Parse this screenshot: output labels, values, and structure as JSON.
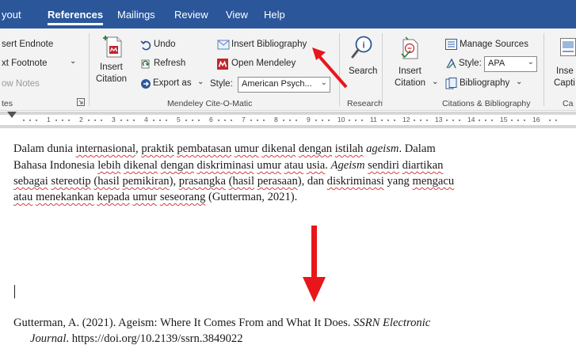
{
  "tabs": [
    "Layout",
    "References",
    "Mailings",
    "Review",
    "View",
    "Help"
  ],
  "tab_visible": {
    "layout": "yout"
  },
  "active_tab": "References",
  "ribbon": {
    "footnotes": {
      "insert_endnote": "sert Endnote",
      "next_footnote": "xt Footnote",
      "next_footnote_chevron": "⌄",
      "show_notes": "ow Notes",
      "group_label": "tes"
    },
    "mendeley": {
      "insert_citation_line1": "Insert",
      "insert_citation_line2": "Citation",
      "undo": "Undo",
      "refresh": "Refresh",
      "export_as": "Export as",
      "insert_bibliography": "Insert Bibliography",
      "open_mendeley": "Open Mendeley",
      "style_label": "Style:",
      "style_value": "American Psych...",
      "group_label": "Mendeley Cite-O-Matic"
    },
    "research": {
      "search": "Search",
      "group_label": "Research"
    },
    "citations": {
      "insert_citation_line1": "Insert",
      "insert_citation_line2": "Citation",
      "manage_sources": "Manage Sources",
      "style_label": "Style:",
      "style_value": "APA",
      "bibliography": "Bibliography",
      "group_label": "Citations & Bibliography"
    },
    "captions": {
      "insert_caption_line1": "Inse",
      "insert_caption_line2": "Capti",
      "group_label": "Ca"
    }
  },
  "ruler": {
    "numbers": [
      "1",
      "2",
      "3",
      "4",
      "5",
      "6",
      "7",
      "8",
      "9",
      "10",
      "11",
      "12",
      "13",
      "14",
      "15",
      "16"
    ]
  },
  "document": {
    "paragraph_lines": [
      [
        {
          "t": "Dalam dunia "
        },
        {
          "t": "internasional",
          "sq": true
        },
        {
          "t": ", "
        },
        {
          "t": "praktik",
          "sq": true
        },
        {
          "t": " "
        },
        {
          "t": "pembatasan",
          "sq": true
        },
        {
          "t": " "
        },
        {
          "t": "umur",
          "sq": true
        },
        {
          "t": " "
        },
        {
          "t": "dikenal",
          "sq": true
        },
        {
          "t": " "
        },
        {
          "t": "dengan",
          "sq": true
        },
        {
          "t": " "
        },
        {
          "t": "istilah",
          "sq": true
        },
        {
          "t": " "
        },
        {
          "t": "ageism",
          "i": true
        },
        {
          "t": ". Dalam"
        }
      ],
      [
        {
          "t": "Bahasa Indonesia "
        },
        {
          "t": "lebih",
          "sq": true
        },
        {
          "t": " "
        },
        {
          "t": "dikenal",
          "sq": true
        },
        {
          "t": " "
        },
        {
          "t": "dengan",
          "sq": true
        },
        {
          "t": " "
        },
        {
          "t": "diskriminasi",
          "sq": true
        },
        {
          "t": " "
        },
        {
          "t": "umur",
          "sq": true
        },
        {
          "t": " "
        },
        {
          "t": "atau",
          "sq": true
        },
        {
          "t": " "
        },
        {
          "t": "usia",
          "sq": true
        },
        {
          "t": ". "
        },
        {
          "t": "Ageism",
          "i": true
        },
        {
          "t": " "
        },
        {
          "t": "sendiri",
          "sq": true
        },
        {
          "t": " "
        },
        {
          "t": "diartikan",
          "sq": true
        }
      ],
      [
        {
          "t": "sebagai",
          "sq": true
        },
        {
          "t": " "
        },
        {
          "t": "stereotip",
          "sq": true
        },
        {
          "t": " "
        },
        {
          "t": "(hasil",
          "sq": true
        },
        {
          "t": " "
        },
        {
          "t": "pemikiran",
          "sq": true
        },
        {
          "t": "), "
        },
        {
          "t": "prasangka",
          "sq": true
        },
        {
          "t": " "
        },
        {
          "t": "(hasil",
          "sq": true
        },
        {
          "t": " "
        },
        {
          "t": "perasaan",
          "sq": true
        },
        {
          "t": "), dan "
        },
        {
          "t": "diskriminasi",
          "sq": true
        },
        {
          "t": " yang "
        },
        {
          "t": "mengacu",
          "sq": true
        }
      ],
      [
        {
          "t": "atau",
          "sq": true
        },
        {
          "t": " "
        },
        {
          "t": "menekankan",
          "sq": true
        },
        {
          "t": " "
        },
        {
          "t": "kepada",
          "sq": true
        },
        {
          "t": " "
        },
        {
          "t": "umur",
          "sq": true
        },
        {
          "t": " "
        },
        {
          "t": "seseorang",
          "sq": true
        },
        {
          "t": " (Gutterman, 2021)."
        }
      ]
    ],
    "reference_line1_plain": "Gutterman, A. (2021). Ageism: Where It Comes From and What It Does. ",
    "reference_line1_italic": "SSRN Electronic",
    "reference_line2_italic": "Journal",
    "reference_line2_plain": ". https://doi.org/10.2139/ssrn.3849022"
  },
  "colors": {
    "tab_bar": "#2b579a",
    "ribbon_bg": "#f3f3f3",
    "annotation_arrow": "#e8161b",
    "spell_squiggle": "#d43c3c"
  }
}
